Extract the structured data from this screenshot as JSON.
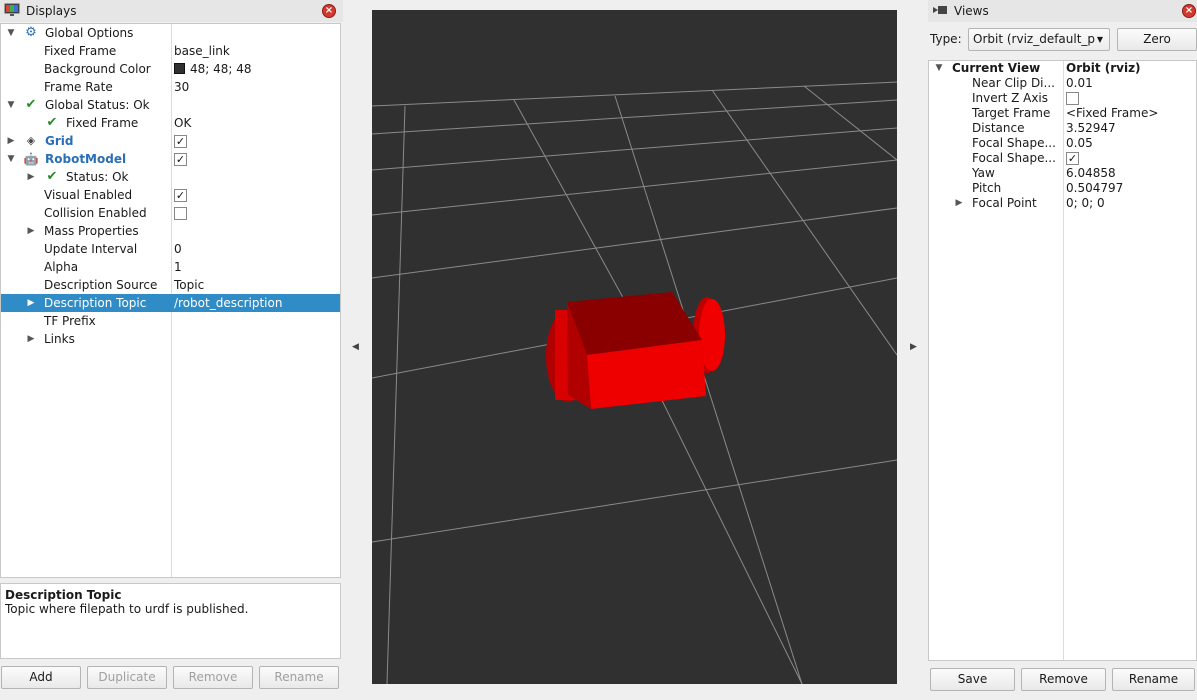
{
  "displays": {
    "title": "Displays",
    "rows": {
      "global_options": {
        "label": "Global Options"
      },
      "fixed_frame": {
        "label": "Fixed Frame",
        "value": "base_link"
      },
      "background_color": {
        "label": "Background Color",
        "value": "48; 48; 48"
      },
      "frame_rate": {
        "label": "Frame Rate",
        "value": "30"
      },
      "global_status": {
        "label": "Global Status: Ok"
      },
      "status_fixed_frame": {
        "label": "Fixed Frame",
        "value": "OK"
      },
      "grid": {
        "label": "Grid",
        "checked": true
      },
      "robot_model": {
        "label": "RobotModel",
        "checked": true
      },
      "rm_status": {
        "label": "Status: Ok"
      },
      "visual_enabled": {
        "label": "Visual Enabled",
        "checked": true
      },
      "collision_enabled": {
        "label": "Collision Enabled",
        "checked": false
      },
      "mass_properties": {
        "label": "Mass Properties"
      },
      "update_interval": {
        "label": "Update Interval",
        "value": "0"
      },
      "alpha": {
        "label": "Alpha",
        "value": "1"
      },
      "description_source": {
        "label": "Description Source",
        "value": "Topic"
      },
      "description_topic": {
        "label": "Description Topic",
        "value": "/robot_description"
      },
      "tf_prefix": {
        "label": "TF Prefix"
      },
      "links": {
        "label": "Links"
      }
    },
    "description": {
      "title": "Description Topic",
      "text": "Topic where filepath to urdf is published."
    },
    "buttons": {
      "add": "Add",
      "duplicate": "Duplicate",
      "remove": "Remove",
      "rename": "Rename"
    }
  },
  "views": {
    "title": "Views",
    "type_label": "Type:",
    "type_value": "Orbit (rviz_default_p",
    "zero_button": "Zero",
    "current_view": {
      "label": "Current View",
      "value": "Orbit (rviz)"
    },
    "props": {
      "near_clip": {
        "label": "Near Clip Di...",
        "value": "0.01"
      },
      "invert_z": {
        "label": "Invert Z Axis",
        "checked": false
      },
      "target_frame": {
        "label": "Target Frame",
        "value": "<Fixed Frame>"
      },
      "distance": {
        "label": "Distance",
        "value": "3.52947"
      },
      "focal_size": {
        "label": "Focal Shape...",
        "value": "0.05"
      },
      "focal_fixed": {
        "label": "Focal Shape...",
        "checked": true
      },
      "yaw": {
        "label": "Yaw",
        "value": "6.04858"
      },
      "pitch": {
        "label": "Pitch",
        "value": "0.504797"
      },
      "focal_point": {
        "label": "Focal Point",
        "value": "0; 0; 0"
      }
    },
    "buttons": {
      "save": "Save",
      "remove": "Remove",
      "rename": "Rename"
    }
  },
  "viewport": {
    "background_color": "#303030",
    "grid_color": "#a0a0a0",
    "robot_color": "#e00000"
  }
}
